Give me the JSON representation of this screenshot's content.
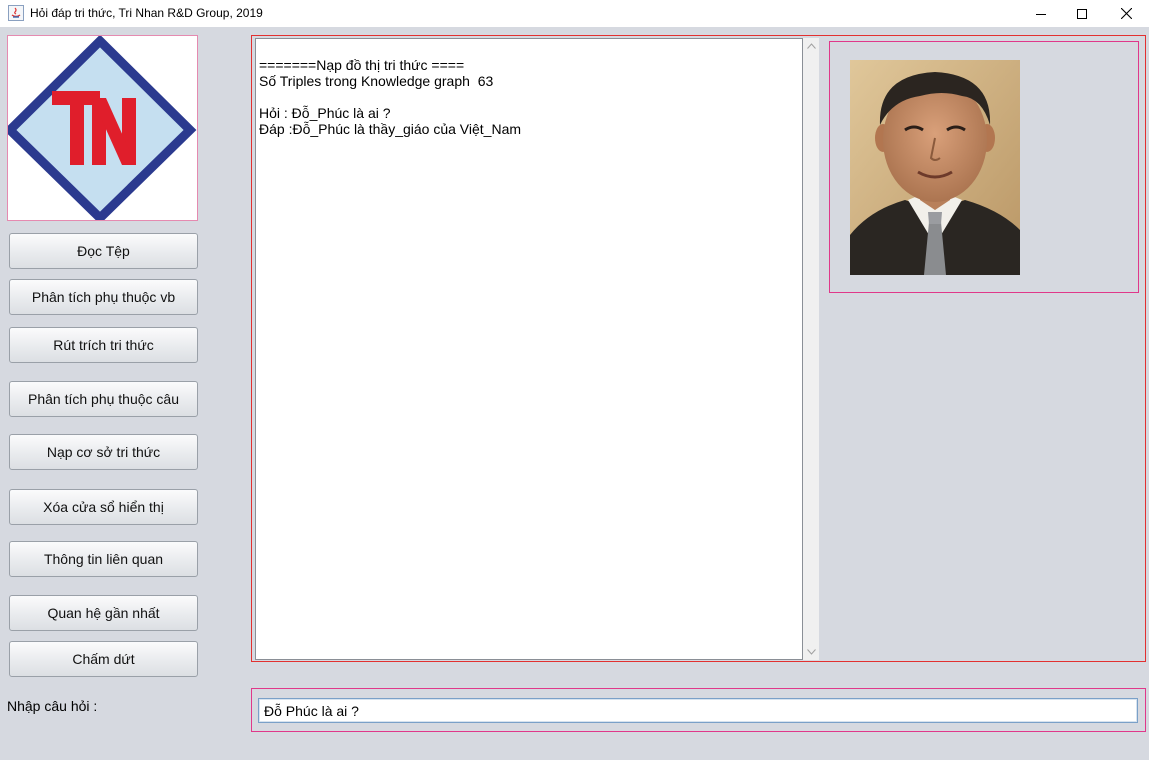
{
  "window": {
    "title": "Hỏi đáp tri thức, Tri Nhan R&D Group, 2019",
    "controls": [
      "minimize",
      "maximize",
      "close"
    ]
  },
  "logo": {
    "text": "TN"
  },
  "buttons": [
    {
      "label": "Đọc Tệp"
    },
    {
      "label": "Phân tích phụ thuộc vb"
    },
    {
      "label": "Rút trích tri thức"
    },
    {
      "label": "Phân tích phụ thuộc câu"
    },
    {
      "label": "Nạp cơ sở tri thức"
    },
    {
      "label": "Xóa cửa sổ hiển thị"
    },
    {
      "label": "Thông tin liên quan"
    },
    {
      "label": "Quan hệ gần nhất"
    },
    {
      "label": "Chấm dứt"
    }
  ],
  "output": {
    "lines": [
      "=======Nạp đồ thị tri thức ====",
      "Số Triples trong Knowledge graph  63",
      "",
      "Hỏi : Đỗ_Phúc là ai ?",
      "Đáp :Đỗ_Phúc là thầy_giáo của Việt_Nam"
    ]
  },
  "question": {
    "label": "Nhập câu hỏi :",
    "value": "Đỗ Phúc là ai ?"
  },
  "colors": {
    "panel_border_red": "#e23030",
    "panel_border_pink": "#e0388a",
    "logo_blue": "#2b3a8f",
    "logo_red": "#e01e2b",
    "background": "#d6d9e0"
  }
}
